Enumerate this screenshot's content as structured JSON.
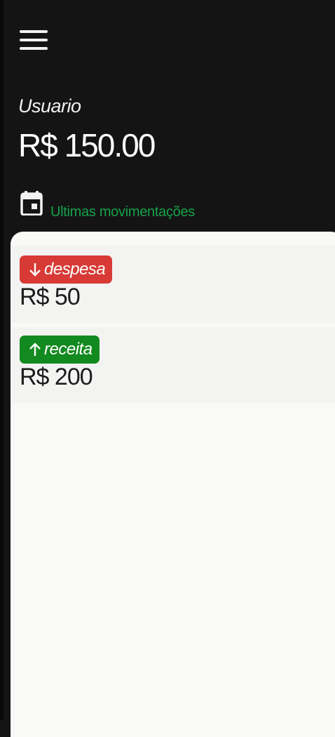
{
  "header": {
    "menu_icon": "hamburger-menu-icon",
    "user_name": "Usuario",
    "balance": "R$ 150.00"
  },
  "section": {
    "icon": "calendar-icon",
    "label": "Ultimas movimentações"
  },
  "transactions": [
    {
      "type": "despesa",
      "arrow_icon": "arrow-down-icon",
      "amount": "R$ 50",
      "color": "#d83a36"
    },
    {
      "type": "receita",
      "arrow_icon": "arrow-up-icon",
      "amount": "R$ 200",
      "color": "#138a1f"
    }
  ]
}
